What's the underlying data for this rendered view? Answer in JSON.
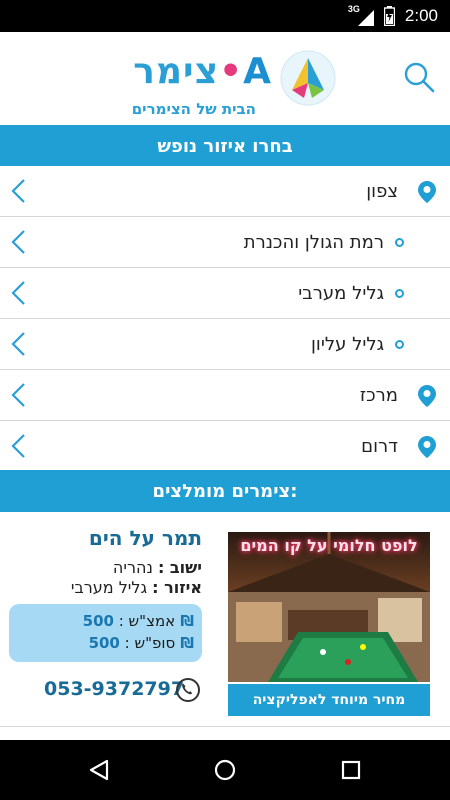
{
  "status_bar": {
    "network": "3G",
    "time": "2:00"
  },
  "header": {
    "logo_word": "צימר",
    "logo_dot": "•",
    "logo_letter": "A",
    "logo_tagline": "הבית של הצימרים",
    "icons": {
      "search": "search-icon",
      "logo": "logo-icon"
    }
  },
  "regions": {
    "title": "בחרו איזור נופש",
    "items": [
      {
        "label": "צפון",
        "kind": "main",
        "icon": "map-pin-icon"
      },
      {
        "label": "רמת הגולן והכנרת",
        "kind": "sub",
        "icon": "bullet-icon"
      },
      {
        "label": "גליל מערבי",
        "kind": "sub",
        "icon": "bullet-icon"
      },
      {
        "label": "גליל עליון",
        "kind": "sub",
        "icon": "bullet-icon"
      },
      {
        "label": "מרכז",
        "kind": "main",
        "icon": "map-pin-icon"
      },
      {
        "label": "דרום",
        "kind": "main",
        "icon": "map-pin-icon"
      }
    ]
  },
  "recommended": {
    "title": "צימרים מומלצים:",
    "card": {
      "name": "תמר על הים",
      "town_label": "ישוב :",
      "town": "נהריה",
      "area_label": "איזור :",
      "area": "גליל מערבי",
      "midweek_label": "אמצ\"ש :",
      "midweek_price": "500 ₪",
      "weekend_label": "סופ\"ש :",
      "weekend_price": "500 ₪",
      "phone": "053-9372797",
      "photo_sign": "לופט חלומי על קו המים",
      "special_price_label": "מחיר מיוחד לאפליקציה"
    }
  },
  "colors": {
    "accent": "#1f9fd4",
    "price_box": "#a6d9f3",
    "title_blue": "#176b96"
  }
}
